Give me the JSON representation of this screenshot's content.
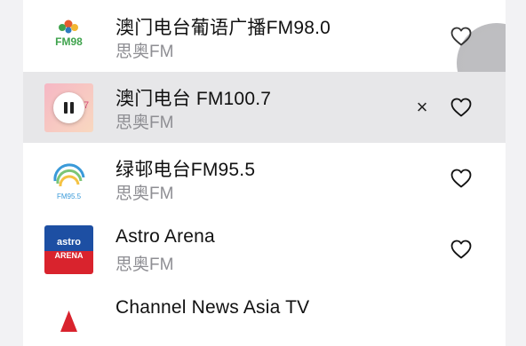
{
  "stations": [
    {
      "title": "澳门电台葡语广播FM98.0",
      "subtitle": "思奥FM",
      "favorite_icon": "heart-outline-icon",
      "logo_text": "FM98",
      "logo_colors": [
        "#3fa34d",
        "#e65c2e",
        "#2f7bbf",
        "#f2b632"
      ]
    },
    {
      "title": "澳门电台 FM100.7",
      "subtitle": "思奥FM",
      "favorite_icon": "heart-outline-icon",
      "playing": true,
      "pause_icon": "pause-icon",
      "close_glyph": "×",
      "logo_colors": [
        "#f6b7c4",
        "#f8d8c0"
      ]
    },
    {
      "title": "绿邨电台FM95.5",
      "subtitle": "思奥FM",
      "favorite_icon": "heart-outline-icon",
      "logo_text": "FM95.5",
      "logo_colors": [
        "#3a9ad9",
        "#7cc576",
        "#f5c242"
      ]
    },
    {
      "title": "Astro Arena",
      "subtitle": "思奥FM",
      "favorite_icon": "heart-outline-icon",
      "logo_text_top": "astro",
      "logo_text_bottom": "ARENA",
      "logo_colors": [
        "#1d4fa3",
        "#d9232d"
      ]
    },
    {
      "title": "Channel News Asia TV",
      "subtitle": "",
      "logo_colors": [
        "#d9232d"
      ]
    }
  ],
  "theme": {
    "active_row_bg": "#e7e7e9",
    "subtitle_color": "#8e8e93",
    "page_bg": "#f2f2f4"
  }
}
